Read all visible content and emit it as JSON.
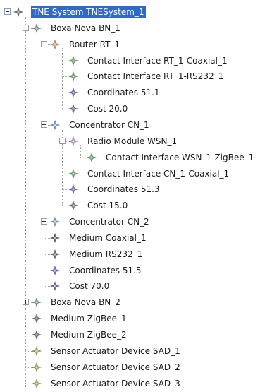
{
  "tree": {
    "colors": {
      "selection": "#3169c6",
      "icon_root": "#6e6e6e",
      "icon_group": "#7f9f8f",
      "icon_router": "#c99a6d",
      "icon_concentrator": "#8aa7c8",
      "icon_interface": "#63b063",
      "icon_coordinates": "#7a6bb3",
      "icon_cost": "#8c6a9a",
      "icon_radio": "#c49ad0",
      "icon_medium": "#6e6e6e",
      "icon_sensor": "#97b86a"
    },
    "nodes": [
      {
        "label": "TNE System TNESystem_1",
        "depth": 0,
        "toggle": "expanded",
        "icon": "root-diamond-icon",
        "color": "#6e6e6e",
        "selected": true
      },
      {
        "label": "Boxa Nova BN_1",
        "depth": 1,
        "toggle": "expanded",
        "icon": "group-diamond-icon",
        "color": "#7f9f8f"
      },
      {
        "label": "Router RT_1",
        "depth": 2,
        "toggle": "expanded",
        "icon": "router-diamond-icon",
        "color": "#c99a6d"
      },
      {
        "label": "Contact Interface RT_1-Coaxial_1",
        "depth": 3,
        "toggle": "none",
        "icon": "interface-diamond-icon",
        "color": "#63b063"
      },
      {
        "label": "Contact Interface RT_1-RS232_1",
        "depth": 3,
        "toggle": "none",
        "icon": "interface-diamond-icon",
        "color": "#63b063"
      },
      {
        "label": "Coordinates 51.1",
        "depth": 3,
        "toggle": "none",
        "icon": "coordinates-diamond-icon",
        "color": "#7a6bb3"
      },
      {
        "label": "Cost 20.0",
        "depth": 3,
        "toggle": "none",
        "icon": "cost-diamond-icon",
        "color": "#8c6a9a"
      },
      {
        "label": "Concentrator CN_1",
        "depth": 2,
        "toggle": "expanded",
        "icon": "concentrator-diamond-icon",
        "color": "#8aa7c8"
      },
      {
        "label": "Radio Module WSN_1",
        "depth": 3,
        "toggle": "expanded",
        "icon": "radio-diamond-icon",
        "color": "#c49ad0"
      },
      {
        "label": "Contact Interface WSN_1-ZigBee_1",
        "depth": 4,
        "toggle": "none",
        "icon": "interface-diamond-icon",
        "color": "#63b063"
      },
      {
        "label": "Contact Interface CN_1-Coaxial_1",
        "depth": 3,
        "toggle": "none",
        "icon": "interface-diamond-icon",
        "color": "#63b063"
      },
      {
        "label": "Coordinates 51.3",
        "depth": 3,
        "toggle": "none",
        "icon": "coordinates-diamond-icon",
        "color": "#7a6bb3"
      },
      {
        "label": "Cost 15.0",
        "depth": 3,
        "toggle": "none",
        "icon": "cost-diamond-icon",
        "color": "#8c6a9a"
      },
      {
        "label": "Concentrator CN_2",
        "depth": 2,
        "toggle": "collapsed",
        "icon": "concentrator-diamond-icon",
        "color": "#8aa7c8"
      },
      {
        "label": "Medium Coaxial_1",
        "depth": 2,
        "toggle": "none",
        "icon": "medium-diamond-icon",
        "color": "#6e6e6e"
      },
      {
        "label": "Medium RS232_1",
        "depth": 2,
        "toggle": "none",
        "icon": "medium-diamond-icon",
        "color": "#6e6e6e"
      },
      {
        "label": "Coordinates 51.5",
        "depth": 2,
        "toggle": "none",
        "icon": "coordinates-diamond-icon",
        "color": "#7a6bb3"
      },
      {
        "label": "Cost 70.0",
        "depth": 2,
        "toggle": "none",
        "icon": "cost-diamond-icon",
        "color": "#8c6a9a"
      },
      {
        "label": "Boxa Nova BN_2",
        "depth": 1,
        "toggle": "collapsed",
        "icon": "group-diamond-icon",
        "color": "#7f9f8f"
      },
      {
        "label": "Medium ZigBee_1",
        "depth": 1,
        "toggle": "none",
        "icon": "medium-diamond-icon",
        "color": "#6e6e6e"
      },
      {
        "label": "Medium ZigBee_2",
        "depth": 1,
        "toggle": "none",
        "icon": "medium-diamond-icon",
        "color": "#6e6e6e"
      },
      {
        "label": "Sensor Actuator Device SAD_1",
        "depth": 1,
        "toggle": "none",
        "icon": "sensor-diamond-icon",
        "color": "#97b86a"
      },
      {
        "label": "Sensor Actuator Device SAD_2",
        "depth": 1,
        "toggle": "none",
        "icon": "sensor-diamond-icon",
        "color": "#97b86a"
      },
      {
        "label": "Sensor Actuator Device SAD_3",
        "depth": 1,
        "toggle": "none",
        "icon": "sensor-diamond-icon",
        "color": "#97b86a"
      }
    ]
  }
}
